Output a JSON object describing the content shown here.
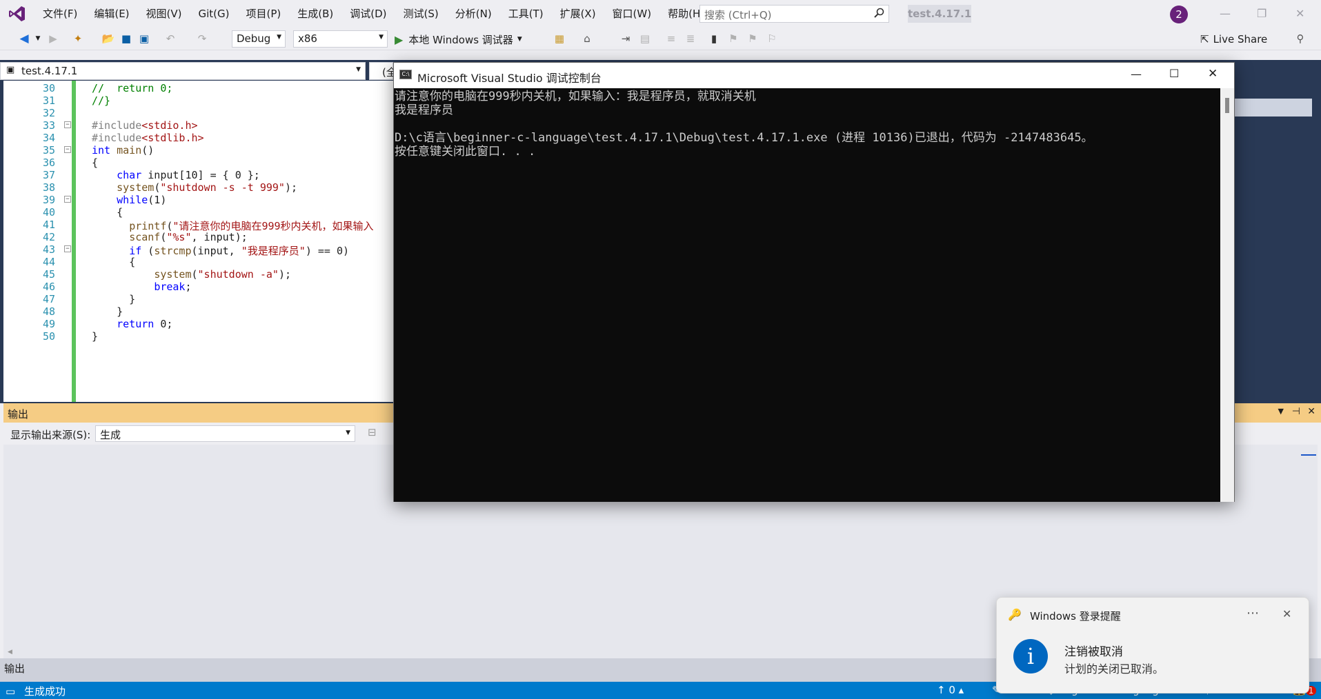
{
  "menubar": {
    "items": [
      "文件(F)",
      "编辑(E)",
      "视图(V)",
      "Git(G)",
      "项目(P)",
      "生成(B)",
      "调试(D)",
      "测试(S)",
      "分析(N)",
      "工具(T)",
      "扩展(X)",
      "窗口(W)",
      "帮助(H)"
    ],
    "search_placeholder": "搜索 (Ctrl+Q)",
    "project_name": "test.4.17.1",
    "avatar_text": "2"
  },
  "toolbar": {
    "config": "Debug",
    "platform": "x86",
    "run_label": "本地 Windows 调试器",
    "live_share": "Live Share"
  },
  "editor": {
    "file_tab": "test.4.17.1",
    "partial_tab": "(全",
    "lines": [
      {
        "n": "30",
        "t": "//  return 0;"
      },
      {
        "n": "31",
        "t": "//}"
      },
      {
        "n": "32",
        "t": ""
      },
      {
        "n": "33",
        "t": "#include<stdio.h>"
      },
      {
        "n": "34",
        "t": "#include<stdlib.h>"
      },
      {
        "n": "35",
        "t": "int main()"
      },
      {
        "n": "36",
        "t": "{"
      },
      {
        "n": "37",
        "t": "    char input[10] = { 0 };"
      },
      {
        "n": "38",
        "t": "    system(\"shutdown -s -t 999\");"
      },
      {
        "n": "39",
        "t": "    while(1)"
      },
      {
        "n": "40",
        "t": "    {"
      },
      {
        "n": "41",
        "t": "      printf(\"请注意你的电脑在999秒内关机，如果输入"
      },
      {
        "n": "42",
        "t": "      scanf(\"%s\", input);"
      },
      {
        "n": "43",
        "t": "      if (strcmp(input, \"我是程序员\") == 0)"
      },
      {
        "n": "44",
        "t": "      {"
      },
      {
        "n": "45",
        "t": "          system(\"shutdown -a\");"
      },
      {
        "n": "46",
        "t": "          break;"
      },
      {
        "n": "47",
        "t": "      }"
      },
      {
        "n": "48",
        "t": "    }"
      },
      {
        "n": "49",
        "t": "    return 0;"
      },
      {
        "n": "50",
        "t": "}"
      }
    ]
  },
  "output": {
    "title": "输出",
    "source_label": "显示输出来源(S):",
    "source_value": "生成",
    "bottom_tab": "输出"
  },
  "console": {
    "title": "Microsoft Visual Studio 调试控制台",
    "lines": [
      "请注意你的电脑在999秒内关机，如果输入：我是程序员，就取消关机",
      "我是程序员",
      "",
      "D:\\c语言\\beginner-c-language\\test.4.17.1\\Debug\\test.4.17.1.exe (进程 10136)已退出，代码为 -2147483645。",
      "按任意键关闭此窗口. . ."
    ]
  },
  "toast": {
    "app": "Windows 登录提醒",
    "title": "注销被取消",
    "body": "计划的关闭已取消。"
  },
  "statusbar": {
    "status": "生成成功",
    "up_count": "0",
    "pencil_count": "99*",
    "repo": "beginner-c-language",
    "branch": "master",
    "notif": "1"
  },
  "colors": {
    "accent": "#007acc",
    "output_header": "#f5cc84",
    "editor_frame": "#293955"
  }
}
